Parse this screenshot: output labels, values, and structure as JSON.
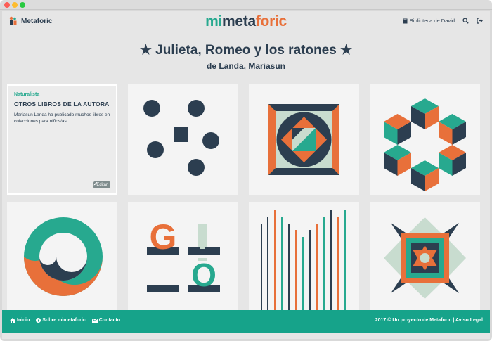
{
  "header": {
    "brand_name": "Metaforic",
    "logo_part1": "mi",
    "logo_part2": "meta",
    "logo_part3": "foric",
    "library_label": "Biblioteca de David"
  },
  "book": {
    "title": "★ Julieta, Romeo y los ratones ★",
    "author": "de Landa, Mariasun"
  },
  "info_card": {
    "category": "Naturalista",
    "heading": "OTROS LIBROS DE LA AUTORA",
    "text": "Mariasun Landa ha publicado muchos libros en colecciones para niños/as.",
    "edit_label": "Editar"
  },
  "tiles": {
    "tile7_letters": [
      "G",
      "I",
      "O"
    ]
  },
  "footer": {
    "links": [
      "Inicio",
      "Sobre mimetaforic",
      "Contacto"
    ],
    "copyright": "2017 © Un proyecto de Metaforic | Aviso Legal"
  },
  "colors": {
    "navy": "#2c3e50",
    "teal": "#27a98f",
    "orange": "#e8703a",
    "mint": "#c8dccf",
    "footer": "#16a38a"
  }
}
